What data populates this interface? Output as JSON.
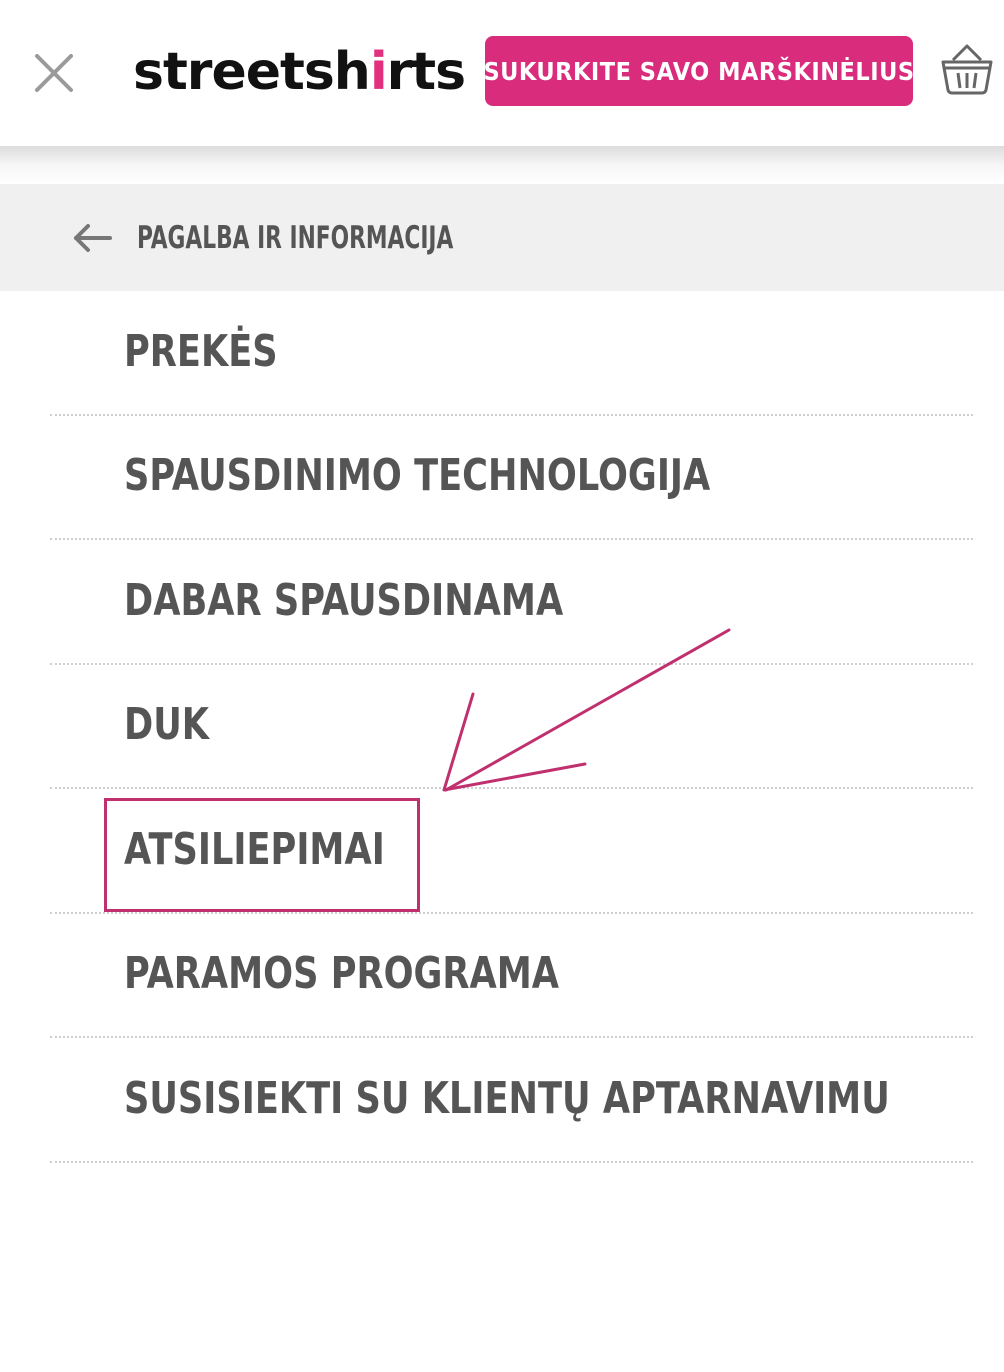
{
  "header": {
    "logo": {
      "part1": "streetsh",
      "part2": "i",
      "part3": "rts"
    },
    "cta_label": "SUKURKITE SAVO MARŠKINĖLIUS",
    "close_icon": "close-icon",
    "cart_icon": "basket-icon",
    "colors": {
      "accent": "#d92c7c",
      "logo": "#111111"
    }
  },
  "back": {
    "icon": "arrow-left-icon",
    "label": "PAGALBA IR INFORMACIJA"
  },
  "menu": {
    "items": [
      {
        "label": "PREKĖS"
      },
      {
        "label": "SPAUSDINIMO TECHNOLOGIJA"
      },
      {
        "label": "DABAR SPAUSDINAMA"
      },
      {
        "label": "DUK"
      },
      {
        "label": "ATSILIEPIMAI",
        "highlighted": true
      },
      {
        "label": "PARAMOS PROGRAMA"
      },
      {
        "label": "SUSISIEKTI SU KLIENTŲ APTARNAVIMU"
      }
    ]
  },
  "annotation": {
    "color": "#c0306e",
    "type": "arrow-and-box"
  }
}
